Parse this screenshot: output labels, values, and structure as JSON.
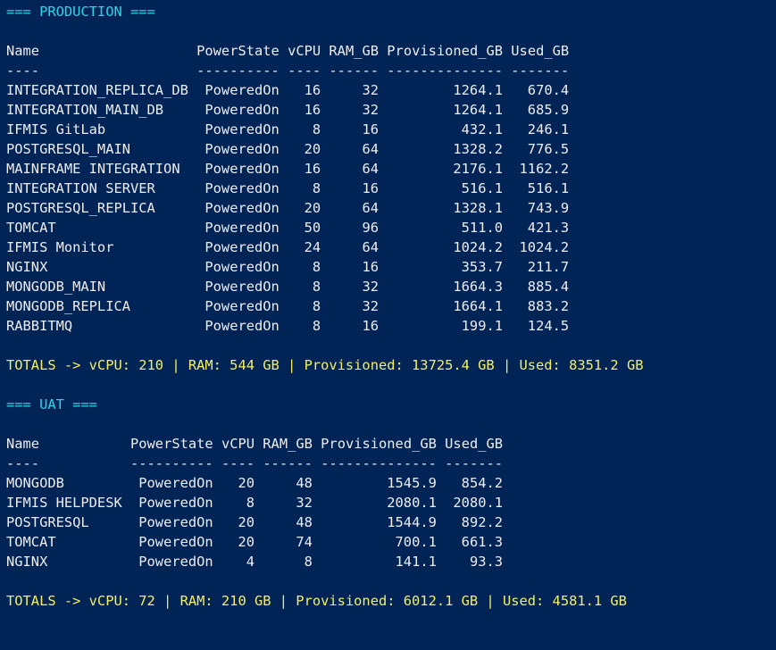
{
  "colors": {
    "background": "#012456",
    "text": "#eeedf0",
    "section_header": "#2fd3e7",
    "totals": "#f2ee6b"
  },
  "production": {
    "header": "=== PRODUCTION ===",
    "columns": [
      "Name",
      "PowerState",
      "vCPU",
      "RAM_GB",
      "Provisioned_GB",
      "Used_GB"
    ],
    "dashes": [
      "----",
      "----------",
      "----",
      "------",
      "--------------",
      "-------"
    ],
    "rows": [
      {
        "name": "INTEGRATION_REPLICA_DB",
        "power": "PoweredOn",
        "vcpu": "16",
        "ram": "32",
        "prov": "1264.1",
        "used": "670.4"
      },
      {
        "name": "INTEGRATION_MAIN_DB",
        "power": "PoweredOn",
        "vcpu": "16",
        "ram": "32",
        "prov": "1264.1",
        "used": "685.9"
      },
      {
        "name": "IFMIS GitLab",
        "power": "PoweredOn",
        "vcpu": "8",
        "ram": "16",
        "prov": "432.1",
        "used": "246.1"
      },
      {
        "name": "POSTGRESQL_MAIN",
        "power": "PoweredOn",
        "vcpu": "20",
        "ram": "64",
        "prov": "1328.2",
        "used": "776.5"
      },
      {
        "name": "MAINFRAME INTEGRATION",
        "power": "PoweredOn",
        "vcpu": "16",
        "ram": "64",
        "prov": "2176.1",
        "used": "1162.2"
      },
      {
        "name": "INTEGRATION SERVER",
        "power": "PoweredOn",
        "vcpu": "8",
        "ram": "16",
        "prov": "516.1",
        "used": "516.1"
      },
      {
        "name": "POSTGRESQL_REPLICA",
        "power": "PoweredOn",
        "vcpu": "20",
        "ram": "64",
        "prov": "1328.1",
        "used": "743.9"
      },
      {
        "name": "TOMCAT",
        "power": "PoweredOn",
        "vcpu": "50",
        "ram": "96",
        "prov": "511.0",
        "used": "421.3"
      },
      {
        "name": "IFMIS Monitor",
        "power": "PoweredOn",
        "vcpu": "24",
        "ram": "64",
        "prov": "1024.2",
        "used": "1024.2"
      },
      {
        "name": "NGINX",
        "power": "PoweredOn",
        "vcpu": "8",
        "ram": "16",
        "prov": "353.7",
        "used": "211.7"
      },
      {
        "name": "MONGODB_MAIN",
        "power": "PoweredOn",
        "vcpu": "8",
        "ram": "32",
        "prov": "1664.3",
        "used": "885.4"
      },
      {
        "name": "MONGODB_REPLICA",
        "power": "PoweredOn",
        "vcpu": "8",
        "ram": "32",
        "prov": "1664.1",
        "used": "883.2"
      },
      {
        "name": "RABBITMQ",
        "power": "PoweredOn",
        "vcpu": "8",
        "ram": "16",
        "prov": "199.1",
        "used": "124.5"
      }
    ],
    "totals": "TOTALS -> vCPU: 210 | RAM: 544 GB | Provisioned: 13725.4 GB | Used: 8351.2 GB"
  },
  "uat": {
    "header": "=== UAT ===",
    "columns": [
      "Name",
      "PowerState",
      "vCPU",
      "RAM_GB",
      "Provisioned_GB",
      "Used_GB"
    ],
    "dashes": [
      "----",
      "----------",
      "----",
      "------",
      "--------------",
      "-------"
    ],
    "rows": [
      {
        "name": "MONGODB",
        "power": "PoweredOn",
        "vcpu": "20",
        "ram": "48",
        "prov": "1545.9",
        "used": "854.2"
      },
      {
        "name": "IFMIS HELPDESK",
        "power": "PoweredOn",
        "vcpu": "8",
        "ram": "32",
        "prov": "2080.1",
        "used": "2080.1"
      },
      {
        "name": "POSTGRESQL",
        "power": "PoweredOn",
        "vcpu": "20",
        "ram": "48",
        "prov": "1544.9",
        "used": "892.2"
      },
      {
        "name": "TOMCAT",
        "power": "PoweredOn",
        "vcpu": "20",
        "ram": "74",
        "prov": "700.1",
        "used": "661.3"
      },
      {
        "name": "NGINX",
        "power": "PoweredOn",
        "vcpu": "4",
        "ram": "8",
        "prov": "141.1",
        "used": "93.3"
      }
    ],
    "totals": "TOTALS -> vCPU: 72 | RAM: 210 GB | Provisioned: 6012.1 GB | Used: 4581.1 GB"
  }
}
